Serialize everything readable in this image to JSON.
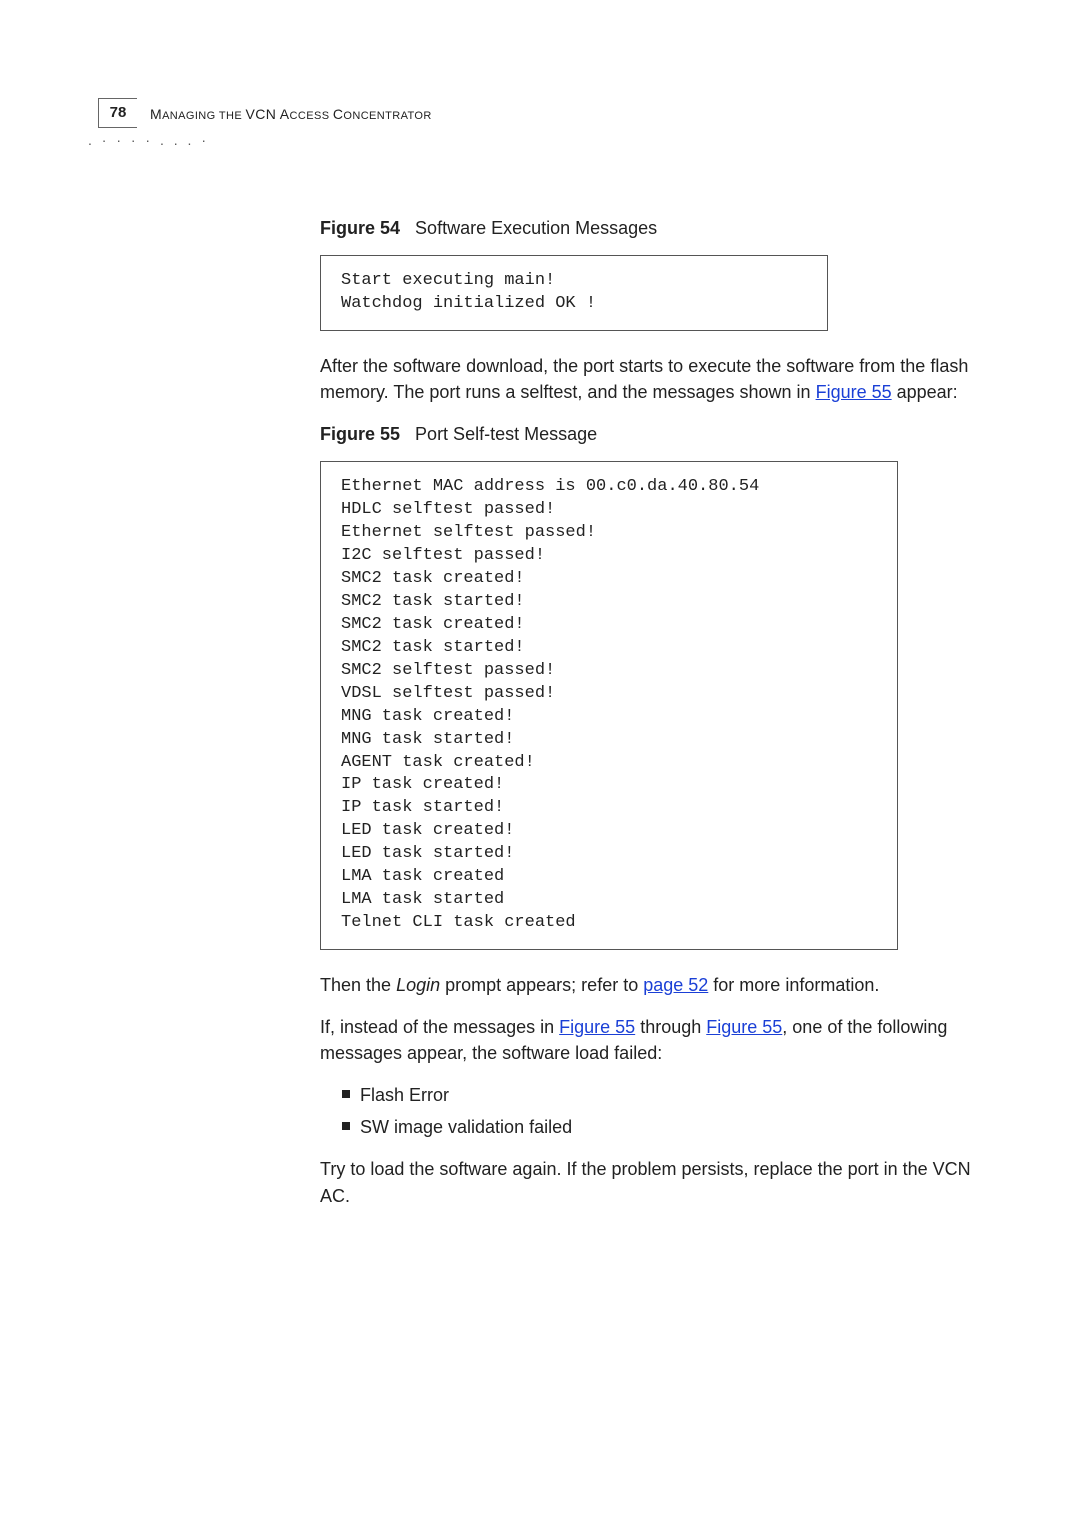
{
  "header": {
    "page_number": "78",
    "running_head_smallcaps_1": "M",
    "running_head_rest_1": "ANAGING THE ",
    "running_head_smallcaps_2": "VCN A",
    "running_head_rest_2": "CCESS ",
    "running_head_smallcaps_3": "C",
    "running_head_rest_3": "ONCENTRATOR",
    "dot_decoration": ". · · · · . . . ·"
  },
  "fig54": {
    "label": "Figure 54",
    "title": "Software Execution Messages",
    "code": "Start executing main!\nWatchdog initialized OK !"
  },
  "para1": {
    "before_link": "After the software download, the port starts to execute the software from the flash memory. The port runs a selftest, and the messages shown in ",
    "link": "Figure 55",
    "after_link": " appear:"
  },
  "fig55": {
    "label": "Figure 55",
    "title": "Port Self-test Message",
    "code": "Ethernet MAC address is 00.c0.da.40.80.54\nHDLC selftest passed!\nEthernet selftest passed!\nI2C selftest passed!\nSMC2 task created!\nSMC2 task started!\nSMC2 task created!\nSMC2 task started!\nSMC2 selftest passed!\nVDSL selftest passed!\nMNG task created!\nMNG task started!\nAGENT task created!\nIP task created!\nIP task started!\nLED task created!\nLED task started!\nLMA task created\nLMA task started\nTelnet CLI task created"
  },
  "para2": {
    "before": "Then the ",
    "italic": "Login",
    "mid": " prompt appears; refer to ",
    "link": "page 52",
    "after": " for more information."
  },
  "para3": {
    "before": "If, instead of the messages in ",
    "link1": "Figure 55",
    "mid": " through ",
    "link2": "Figure 55",
    "after": ", one of the following messages appear, the software load failed:"
  },
  "bullets": {
    "b1": "Flash Error",
    "b2": "SW image validation failed"
  },
  "para4": "Try to load the software again. If the problem persists, replace the port in the VCN AC."
}
